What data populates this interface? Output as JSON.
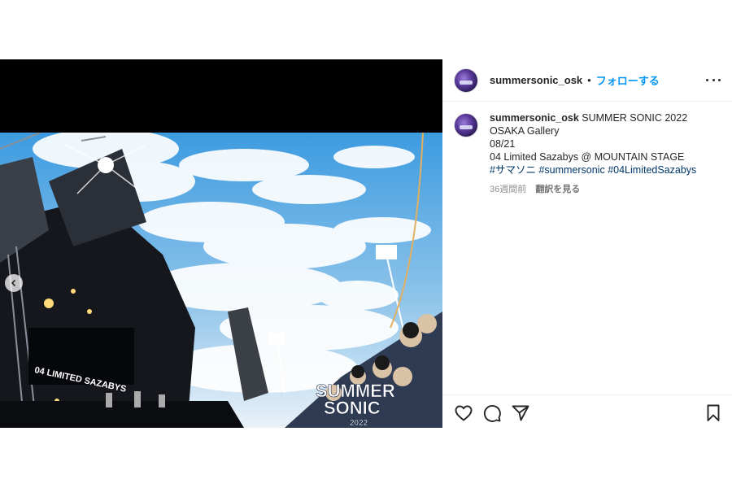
{
  "header": {
    "username": "summersonic_osk",
    "separator": "•",
    "follow_label": "フォローする"
  },
  "caption": {
    "username": "summersonic_osk",
    "line1": "SUMMER SONIC 2022",
    "line2": "OSAKA Gallery",
    "line3": "08/21",
    "line4": "04 Limited Sazabys @ MOUNTAIN STAGE",
    "hashtags": [
      "#サマソニ",
      "#summersonic",
      "#04LimitedSazabys"
    ],
    "time": "36週間前",
    "translate": "翻訳を見る"
  },
  "photo": {
    "band_banner": "04 LIMITED SAZABYS",
    "logo_line1": "SUMMER",
    "logo_line2": "SONIC",
    "logo_line3": "2022"
  },
  "icons": {
    "like": "heart-icon",
    "comment": "comment-icon",
    "share": "paper-plane-icon",
    "save": "bookmark-icon",
    "more": "more-icon",
    "carousel_prev": "chevron-left-icon"
  }
}
